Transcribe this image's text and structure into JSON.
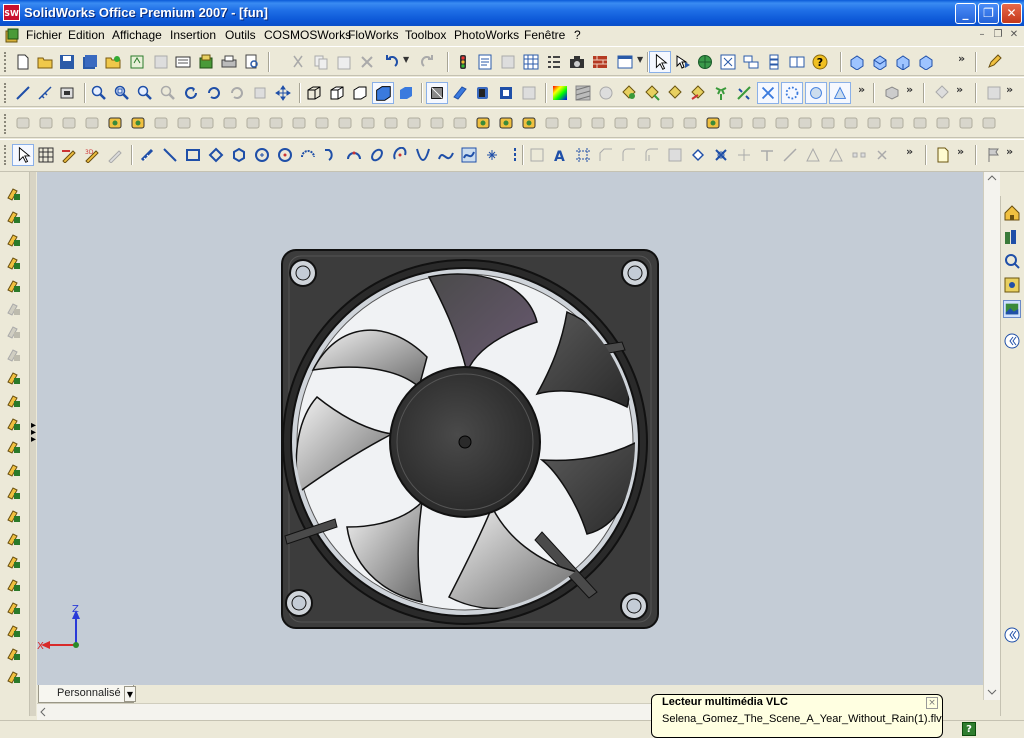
{
  "window": {
    "title": "SolidWorks Office Premium 2007 - [fun]",
    "app_icon_text": "SW"
  },
  "menu": {
    "items": [
      "Fichier",
      "Edition",
      "Affichage",
      "Insertion",
      "Outils",
      "COSMOSWorks",
      "FloWorks",
      "Toolbox",
      "PhotoWorks",
      "Fenêtre",
      "?"
    ]
  },
  "toolbars": {
    "overflow_symbol": "»"
  },
  "triad": {
    "z_label": "Z",
    "x_label": "X"
  },
  "tabs": {
    "active_label": "Personnalisé"
  },
  "vlc_notification": {
    "title": "Lecteur multimédia VLC",
    "body": "Selena_Gomez_The_Scene_A_Year_Without_Rain(1).flv"
  },
  "colors": {
    "title_bar": "#0a56d6",
    "viewport_bg": "#c4ccd6",
    "chrome": "#ece9d8",
    "fan_body": "#3c3c3c"
  }
}
